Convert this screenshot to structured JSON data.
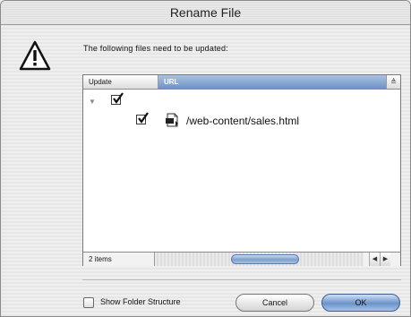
{
  "dialog": {
    "title": "Rename File",
    "message": "The following files need to be updated:"
  },
  "table": {
    "columns": [
      "Update",
      "URL"
    ],
    "sort_indicator": "≜",
    "rows": [
      {
        "checked": true,
        "expanded": true,
        "url": ""
      },
      {
        "checked": true,
        "url": "/web-content/sales.html"
      }
    ],
    "item_count": "2 items"
  },
  "footer": {
    "show_folder_structure_label": "Show Folder Structure",
    "show_folder_structure_checked": false,
    "cancel_label": "Cancel",
    "ok_label": "OK"
  },
  "icons": {
    "warning": "warning-triangle-icon",
    "file": "html-file-icon"
  },
  "colors": {
    "accent": "#6e92c4",
    "default_button": "#7f9fcc"
  }
}
